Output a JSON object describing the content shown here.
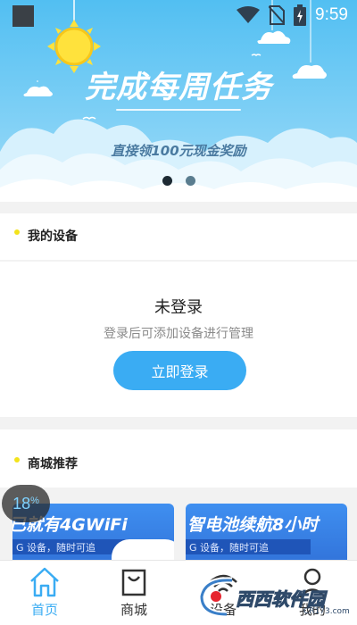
{
  "status_bar": {
    "time": "9:59",
    "icons": [
      "app-square-icon",
      "wifi-icon",
      "no-sim-icon",
      "battery-charging-icon"
    ]
  },
  "banner": {
    "title": "完成每周任务",
    "subtitle": "直接领100元现金奖励",
    "slide_count": 2,
    "active_slide": 1,
    "colors": {
      "sky": "#5cc4f4",
      "cloud": "#ffffff",
      "sun": "#ffe03a"
    }
  },
  "devices_section": {
    "title": "我的设备",
    "status": "未登录",
    "hint": "登录后可添加设备进行管理",
    "login_button": "立即登录"
  },
  "shop_section": {
    "title": "商城推荐",
    "cards": [
      {
        "headline": "已就有4GWiFi",
        "subline": "G 设备，随时可追"
      },
      {
        "headline": "智电池续航8小时",
        "subline": "G 设备，随时可追"
      }
    ]
  },
  "progress_bubble": {
    "value": "18",
    "unit": "%"
  },
  "bottom_nav": {
    "items": [
      {
        "label": "首页",
        "icon": "home-icon",
        "active": true
      },
      {
        "label": "商城",
        "icon": "shopping-bag-icon",
        "active": false
      },
      {
        "label": "设备",
        "icon": "wifi-device-icon",
        "active": false
      },
      {
        "label": "我的",
        "icon": "user-icon",
        "active": false
      }
    ]
  },
  "watermark": {
    "text": "西西软件园",
    "sub": "CR173.com"
  },
  "colors": {
    "accent": "#3aacf3",
    "section_dot": "#f3e31b"
  }
}
